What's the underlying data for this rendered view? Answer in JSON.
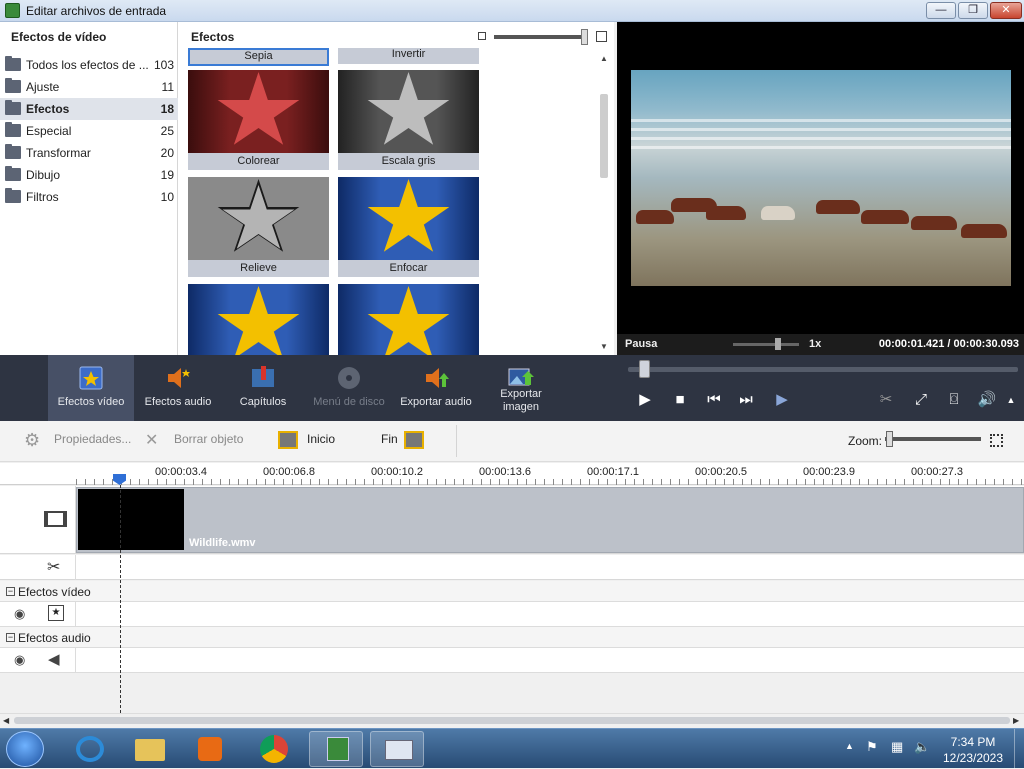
{
  "window": {
    "title": "Editar archivos de entrada",
    "min": "—",
    "max": "❐",
    "close": "✕"
  },
  "left_panel": {
    "title": "Efectos de vídeo",
    "categories": [
      {
        "label": "Todos los efectos de ...",
        "count": "103"
      },
      {
        "label": "Ajuste",
        "count": "11"
      },
      {
        "label": "Efectos",
        "count": "18",
        "selected": true
      },
      {
        "label": "Especial",
        "count": "25"
      },
      {
        "label": "Transformar",
        "count": "20"
      },
      {
        "label": "Dibujo",
        "count": "19"
      },
      {
        "label": "Filtros",
        "count": "10"
      }
    ]
  },
  "effects_panel": {
    "title": "Efectos",
    "tiles": [
      {
        "label": "Sepia",
        "style": "partial"
      },
      {
        "label": "Invertir",
        "style": "partial"
      },
      {
        "label": "Colorear",
        "style": "red-star"
      },
      {
        "label": "Escala gris",
        "style": "gray-star"
      },
      {
        "label": "Relieve",
        "style": "outline-star"
      },
      {
        "label": "Enfocar",
        "style": "gold-star"
      },
      {
        "label": "",
        "style": "gold-star"
      },
      {
        "label": "",
        "style": "gold-star"
      }
    ]
  },
  "preview": {
    "state": "Pausa",
    "speed": "1x",
    "current_time": "00:00:01.421",
    "separator": "/",
    "total_time": "00:00:30.093"
  },
  "toolbar": {
    "buttons": [
      {
        "label": "Efectos vídeo",
        "icon": "video-effects-icon",
        "active": true
      },
      {
        "label": "Efectos audio",
        "icon": "audio-effects-icon"
      },
      {
        "label": "Capítulos",
        "icon": "chapters-icon"
      },
      {
        "label": "Menú de disco",
        "icon": "disc-menu-icon",
        "disabled": true
      },
      {
        "label": "Exportar audio",
        "icon": "export-audio-icon"
      },
      {
        "label": "Exportar imagen",
        "icon": "export-image-icon"
      }
    ]
  },
  "edit_bar": {
    "properties": "Propiedades...",
    "delete": "Borrar objeto",
    "start": "Inicio",
    "end": "Fin",
    "zoom_label": "Zoom:"
  },
  "timeline": {
    "ticks": [
      "00:00:03.4",
      "00:00:06.8",
      "00:00:10.2",
      "00:00:13.6",
      "00:00:17.1",
      "00:00:20.5",
      "00:00:23.9",
      "00:00:27.3"
    ],
    "clip_name": "Wildlife.wmv",
    "video_effects_section": "Efectos vídeo",
    "audio_effects_section": "Efectos audio"
  },
  "taskbar": {
    "time": "7:34 PM",
    "date": "12/23/2023"
  }
}
